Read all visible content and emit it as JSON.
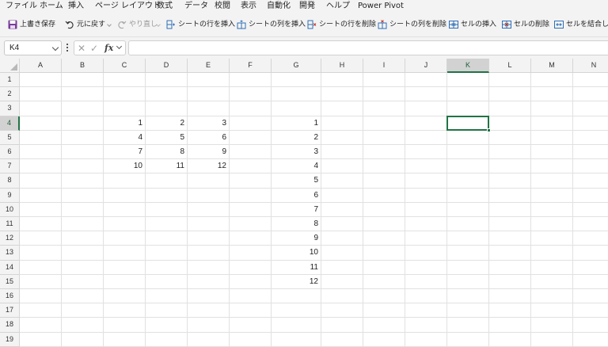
{
  "menu": {
    "items": [
      "ファイル",
      "ホーム",
      "挿入",
      "ページ レイアウト",
      "数式",
      "データ",
      "校閲",
      "表示",
      "自動化",
      "開発",
      "ヘルプ",
      "Power Pivot"
    ]
  },
  "toolbar": {
    "save_label": "上書き保存",
    "undo_label": "元に戻す",
    "redo_label": "やり直し",
    "insert_sheet_rows": "シートの行を挿入",
    "insert_sheet_cols": "シートの列を挿入",
    "delete_sheet_rows": "シートの行を削除",
    "delete_sheet_cols": "シートの列を削除",
    "insert_cells": "セルの挿入",
    "delete_cells": "セルの削除",
    "merge_cells": "セルを結合して"
  },
  "formula_bar": {
    "name_box": "K4",
    "fx_label": "fx",
    "cancel_glyph": "✕",
    "enter_glyph": "✓",
    "formula": ""
  },
  "sheet": {
    "columns": [
      "A",
      "B",
      "C",
      "D",
      "E",
      "F",
      "G",
      "H",
      "I",
      "J",
      "K",
      "L",
      "M",
      "N"
    ],
    "rows": [
      "1",
      "2",
      "3",
      "4",
      "5",
      "6",
      "7",
      "8",
      "9",
      "10",
      "11",
      "12",
      "13",
      "14",
      "15",
      "16",
      "17",
      "18",
      "19"
    ],
    "selected_cell": "K4",
    "cells": {
      "C4": "1",
      "D4": "2",
      "E4": "3",
      "C5": "4",
      "D5": "5",
      "E5": "6",
      "C6": "7",
      "D6": "8",
      "E6": "9",
      "C7": "10",
      "D7": "11",
      "E7": "12",
      "G4": "1",
      "G5": "2",
      "G6": "3",
      "G7": "4",
      "G8": "5",
      "G9": "6",
      "G10": "7",
      "G11": "8",
      "G12": "9",
      "G13": "10",
      "G14": "11",
      "G15": "12"
    }
  },
  "colors": {
    "accent": "#217346",
    "save_icon": "#7a3d99",
    "insert_icon": "#2e6fb7",
    "delete_icon": "#c0392b"
  }
}
